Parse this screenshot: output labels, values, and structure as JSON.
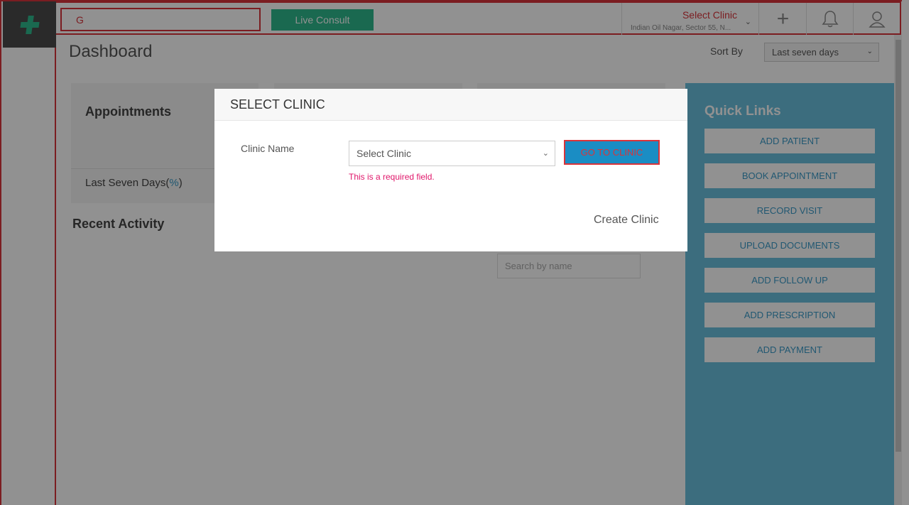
{
  "header": {
    "search_value": "G",
    "live_consult_label": "Live Consult",
    "clinic_title": "Select Clinic",
    "clinic_address": "Indian Oil Nagar, Sector 55, N...",
    "add_icon": "plus-icon",
    "notification_icon": "bell-icon",
    "profile_icon": "user-icon"
  },
  "brand": {
    "logo_icon": "medical-cross-icon",
    "accent": "#2fb98e"
  },
  "dashboard": {
    "title": "Dashboard",
    "sort_label": "Sort By",
    "sort_value": "Last seven days",
    "appointments_title": "Appointments",
    "last_seven_days_label": "Last Seven Days(",
    "last_seven_days_pct": "%",
    "last_seven_days_close": ")",
    "recent_activity_title": "Recent Activity",
    "search_placeholder": "Search by name"
  },
  "quick_links": {
    "title": "Quick Links",
    "items": [
      "ADD PATIENT",
      "BOOK APPOINTMENT",
      "RECORD VISIT",
      "UPLOAD DOCUMENTS",
      "ADD FOLLOW UP",
      "ADD PRESCRIPTION",
      "ADD PAYMENT"
    ]
  },
  "modal": {
    "title": "SELECT CLINIC",
    "clinic_name_label": "Clinic Name",
    "clinic_select_value": "Select Clinic",
    "required_message": "This is a required field.",
    "go_button": "GO TO CLINIC",
    "create_clinic": "Create Clinic"
  },
  "colors": {
    "error_outline": "#d9343a",
    "quick_panel": "#6ac0de",
    "primary_button": "#1a8dc4",
    "required_text": "#e0166a"
  }
}
